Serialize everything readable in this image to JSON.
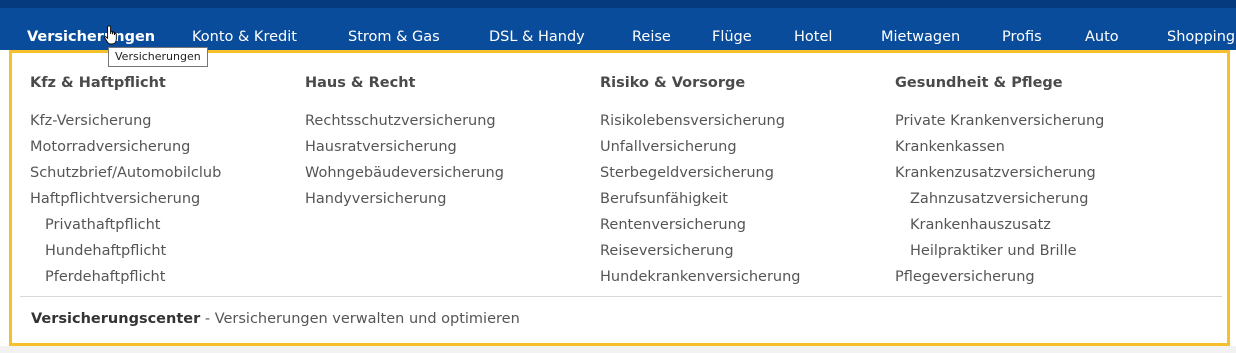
{
  "nav": {
    "items": [
      {
        "label": "Versicherungen"
      },
      {
        "label": "Konto & Kredit"
      },
      {
        "label": "Strom & Gas"
      },
      {
        "label": "DSL & Handy"
      },
      {
        "label": "Reise"
      },
      {
        "label": "Flüge"
      },
      {
        "label": "Hotel"
      },
      {
        "label": "Mietwagen"
      },
      {
        "label": "Profis"
      },
      {
        "label": "Auto"
      },
      {
        "label": "Shopping"
      }
    ],
    "tooltip": "Versicherungen",
    "cursor_icon": "hand-pointer-icon"
  },
  "dropdown": {
    "columns": [
      {
        "heading": "Kfz & Haftpflicht",
        "links": [
          "Kfz-Versicherung",
          "Motorradversicherung",
          "Schutzbrief/Automobilclub",
          "Haftpflichtversicherung",
          "Privathaftpflicht",
          "Hundehaftpflicht",
          "Pferdehaftpflicht"
        ]
      },
      {
        "heading": "Haus & Recht",
        "links": [
          "Rechtsschutzversicherung",
          "Hausratversicherung",
          "Wohngebäudeversicherung",
          "Handyversicherung"
        ]
      },
      {
        "heading": "Risiko & Vorsorge",
        "links": [
          "Risikolebensversicherung",
          "Unfallversicherung",
          "Sterbegeldversicherung",
          "Berufsunfähigkeit",
          "Rentenversicherung",
          "Reiseversicherung",
          "Hundekrankenversicherung"
        ]
      },
      {
        "heading": "Gesundheit & Pflege",
        "links": [
          "Private Krankenversicherung",
          "Krankenkassen",
          "Krankenzusatzversicherung",
          "Zahnzusatzversicherung",
          "Krankenhauszusatz",
          "Heilpraktiker und Brille",
          "Pflegeversicherung"
        ]
      }
    ],
    "footer": {
      "title": "Versicherungscenter",
      "text": " - Versicherungen verwalten und optimieren"
    }
  },
  "colors": {
    "nav_bg": "#0a4c9c",
    "dropdown_border": "#f5c02a"
  }
}
